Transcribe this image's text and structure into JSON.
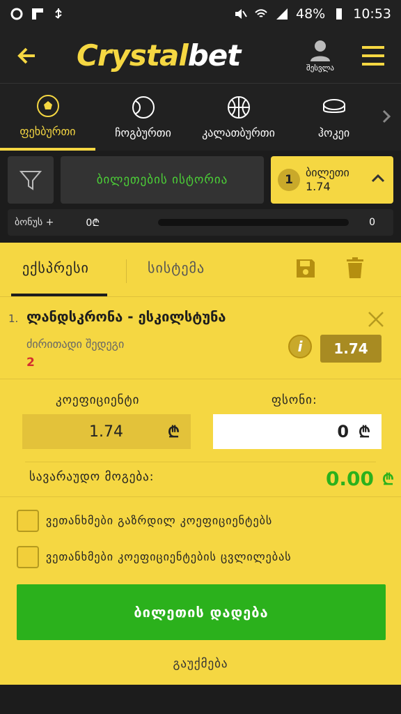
{
  "status": {
    "battery": "48%",
    "time": "10:53"
  },
  "header": {
    "logo_part1": "Crystal",
    "logo_part2": "bet",
    "user_label": "შესვლა"
  },
  "sports": [
    {
      "label": "ფეხბურთი",
      "active": true
    },
    {
      "label": "ჩოგბურთი",
      "active": false
    },
    {
      "label": "კალათბურთი",
      "active": false
    },
    {
      "label": "ჰოკეი",
      "active": false
    }
  ],
  "controls": {
    "history_label": "ბილეთების ისტორია",
    "ticket_count": "1",
    "ticket_label": "ბილეთი",
    "ticket_odds": "1.74"
  },
  "bonus": {
    "label": "ბონუს +",
    "value": "0₾",
    "end_value": "0"
  },
  "slip": {
    "tabs": {
      "express": "ექსპრესი",
      "system": "სისტემა"
    },
    "event": {
      "index": "1.",
      "name": "ლანდსკრონა - ესკილსტუნა",
      "market": "ძირითადი შედეგი",
      "pick": "2",
      "odds": "1.74"
    },
    "coef_label": "კოეფიციენტი",
    "coef_value": "1.74",
    "stake_label": "ფსონი:",
    "stake_value": "0",
    "currency": "₾",
    "win_label": "სავარაუდო მოგება:",
    "win_value": "0.00",
    "check1": "ვეთანხმები გაზრდილ კოეფიციენტებს",
    "check2": "ვეთანხმები კოეფიციენტების ცვლილებას",
    "place_label": "ბილეთის დადება",
    "cancel_label": "გაუქმება"
  }
}
